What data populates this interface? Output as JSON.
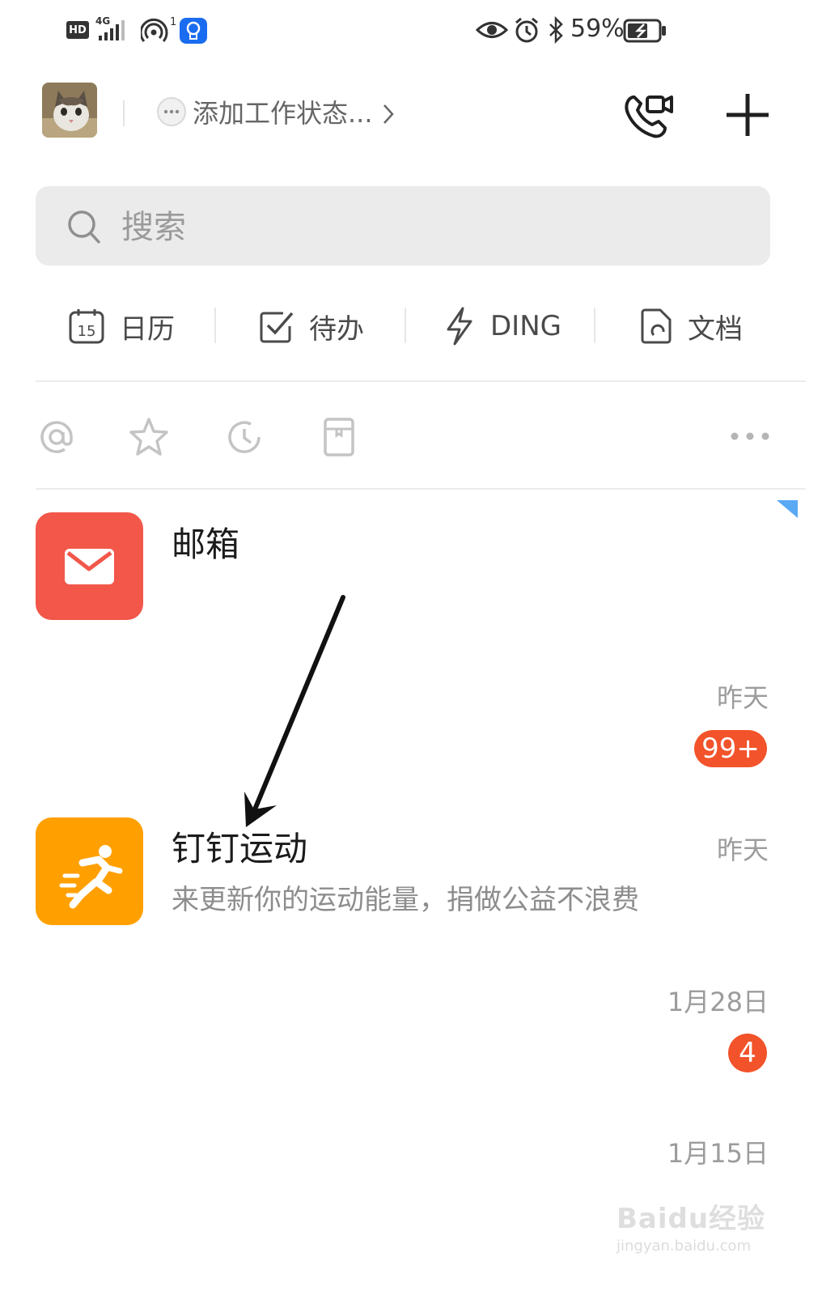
{
  "status_bar": {
    "hd": "HD",
    "network": "4G",
    "hotspot_count": "1",
    "battery": "59%"
  },
  "header": {
    "work_status": "添加工作状态..."
  },
  "search": {
    "placeholder": "搜索"
  },
  "quick_actions": [
    {
      "label": "日历",
      "icon": "calendar-icon",
      "day": "15"
    },
    {
      "label": "待办",
      "icon": "checkbox-icon"
    },
    {
      "label": "DING",
      "icon": "lightning-icon"
    },
    {
      "label": "文档",
      "icon": "document-icon"
    }
  ],
  "filters": [
    "at-icon",
    "star-icon",
    "clock-icon",
    "memo-icon",
    "more-icon"
  ],
  "conversations": [
    {
      "title": "邮箱",
      "subtitle": "",
      "time": "",
      "badge": "",
      "icon": "mail-icon",
      "color": "#f2574a"
    },
    {
      "title": "",
      "subtitle": "",
      "time": "昨天",
      "badge": "99+",
      "icon": "",
      "color": ""
    },
    {
      "title": "钉钉运动",
      "subtitle": "来更新你的运动能量，捐做公益不浪费",
      "time": "昨天",
      "badge": "",
      "icon": "runner-icon",
      "color": "#ffa000"
    },
    {
      "title": "",
      "subtitle": "",
      "time": "1月28日",
      "badge": "4",
      "icon": "",
      "color": ""
    },
    {
      "title": "",
      "subtitle": "",
      "time": "1月15日",
      "badge": "",
      "icon": "",
      "color": ""
    }
  ],
  "colors": {
    "badge": "#f2532a",
    "search_bg": "#ebebec",
    "mail_icon": "#f2574a",
    "sport_icon": "#ffa000",
    "pin_corner": "#5aa9f5"
  },
  "watermark": {
    "brand": "Baidu经验",
    "url": "jingyan.baidu.com"
  }
}
